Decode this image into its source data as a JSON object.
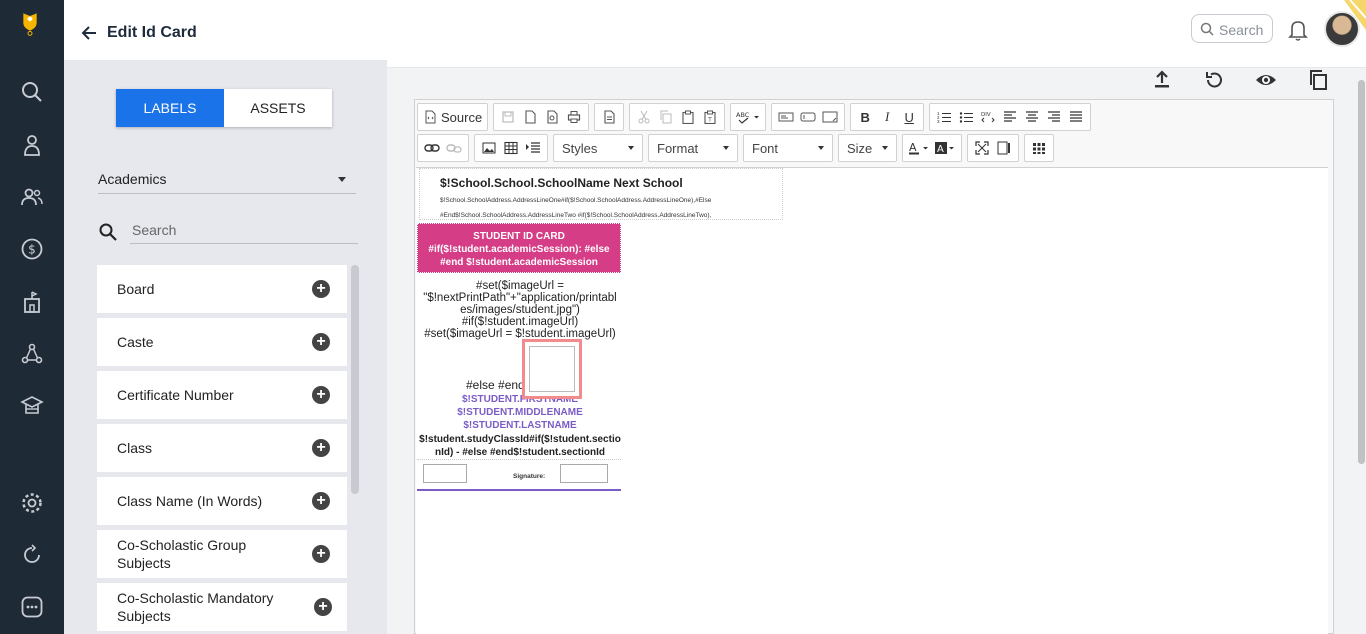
{
  "header": {
    "title": "Edit Id Card",
    "search_placeholder": "Search"
  },
  "panel": {
    "tabs": {
      "labels": "LABELS",
      "assets": "ASSETS"
    },
    "category_value": "Academics",
    "search_placeholder": "Search",
    "items": [
      "Board",
      "Caste",
      "Certificate Number",
      "Class",
      "Class Name (In Words)",
      "Co-Scholastic Group Subjects",
      "Co-Scholastic Mandatory Subjects"
    ]
  },
  "toolbar": {
    "source": "Source",
    "styles": "Styles",
    "format": "Format",
    "font": "Font",
    "size": "Size"
  },
  "card": {
    "school_name": "$!School.School.SchoolName Next School",
    "address_1": "$!School.SchoolAddress.AddressLineOne#if($!School.SchoolAddress.AddressLineOne),#Else",
    "address_2": "#End$!School.SchoolAddress.AddressLineTwo #if($!School.SchoolAddress.AddressLineTwo),",
    "banner_1": "STUDENT ID CARD",
    "banner_2": "#if($!student.academicSession): #else",
    "banner_3": "#end $!student.academicSession",
    "code_1": "#set($imageUrl =",
    "code_2": "\"$!nextPrintPath\"+\"application/printabl",
    "code_3": "es/images/student.jpg\")",
    "code_4": "#if($!student.imageUrl)",
    "code_5": "#set($imageUrl = $!student.imageUrl)",
    "else_text": "#else #end",
    "first_name": "$!STUDENT.FIRSTNAME",
    "middle_name": "$!STUDENT.MIDDLENAME",
    "last_name": "$!STUDENT.LASTNAME",
    "class_1": "$!student.studyClassId#if($!student.sectio",
    "class_2": "nId) - #else #end$!student.sectionId",
    "signature_label": "Signature:"
  }
}
